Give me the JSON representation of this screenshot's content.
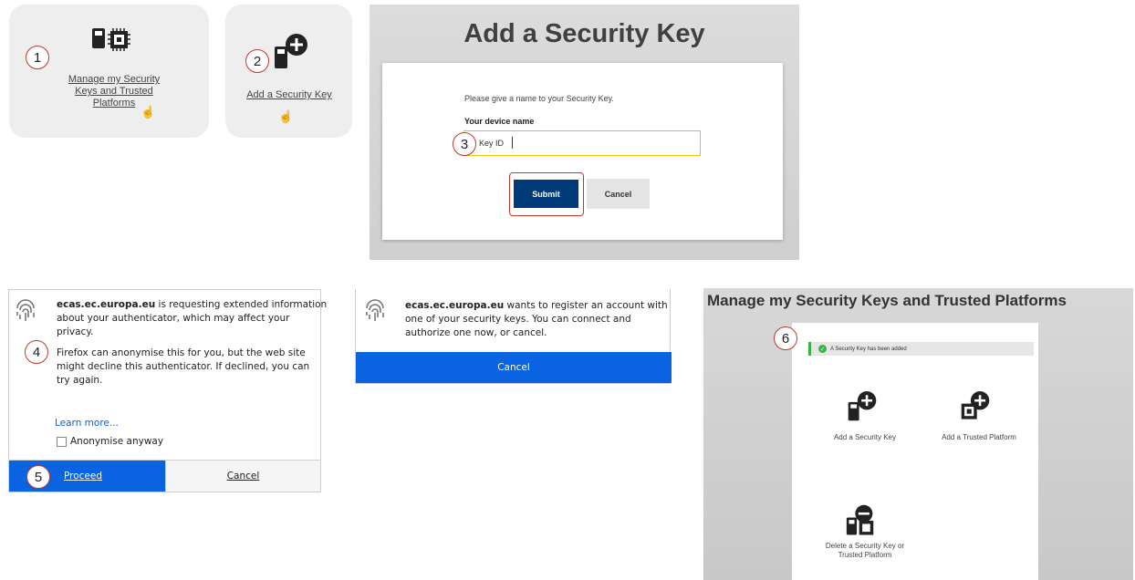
{
  "panel1": {
    "step": "1",
    "link_lines": [
      "Manage my Security",
      "Keys and Trusted",
      "Platforms"
    ]
  },
  "panel2": {
    "step": "2",
    "link": "Add a Security Key"
  },
  "panel3": {
    "step": "3",
    "title": "Add a Security Key",
    "prompt": "Please give a name to your Security Key.",
    "field_label": "Your device name",
    "field_value": "Key ID",
    "submit": "Submit",
    "cancel": "Cancel"
  },
  "panel4": {
    "step_info": "4",
    "step_proceed": "5",
    "domain": "ecas.ec.europa.eu",
    "line1": " is requesting extended information",
    "line2": "about your authenticator, which may affect your",
    "line3": "privacy.",
    "line4": "Firefox can anonymise this for you, but the web site",
    "line5": "might decline this authenticator. If declined, you can",
    "line6": "try again.",
    "learn_more": "Learn more...",
    "checkbox_label": "Anonymise anyway",
    "proceed": "Proceed",
    "cancel": "Cancel"
  },
  "panel5": {
    "domain": "ecas.ec.europa.eu",
    "line1": " wants to register an account with",
    "line2": "one of your security keys. You can connect and",
    "line3": "authorize one now, or cancel.",
    "cancel": "Cancel"
  },
  "panel6": {
    "step": "6",
    "title": "Manage my Security Keys and Trusted Platforms",
    "success": "A Security Key has been added",
    "add_key": "Add a Security Key",
    "add_platform": "Add a Trusted Platform",
    "delete_lines": [
      "Delete a Security Key or",
      "Trusted Platform"
    ]
  },
  "colors": {
    "accent_blue": "#0a63e0",
    "submit_navy": "#003a7a",
    "step_ring": "#c0392b",
    "success_green": "#3cb043"
  }
}
